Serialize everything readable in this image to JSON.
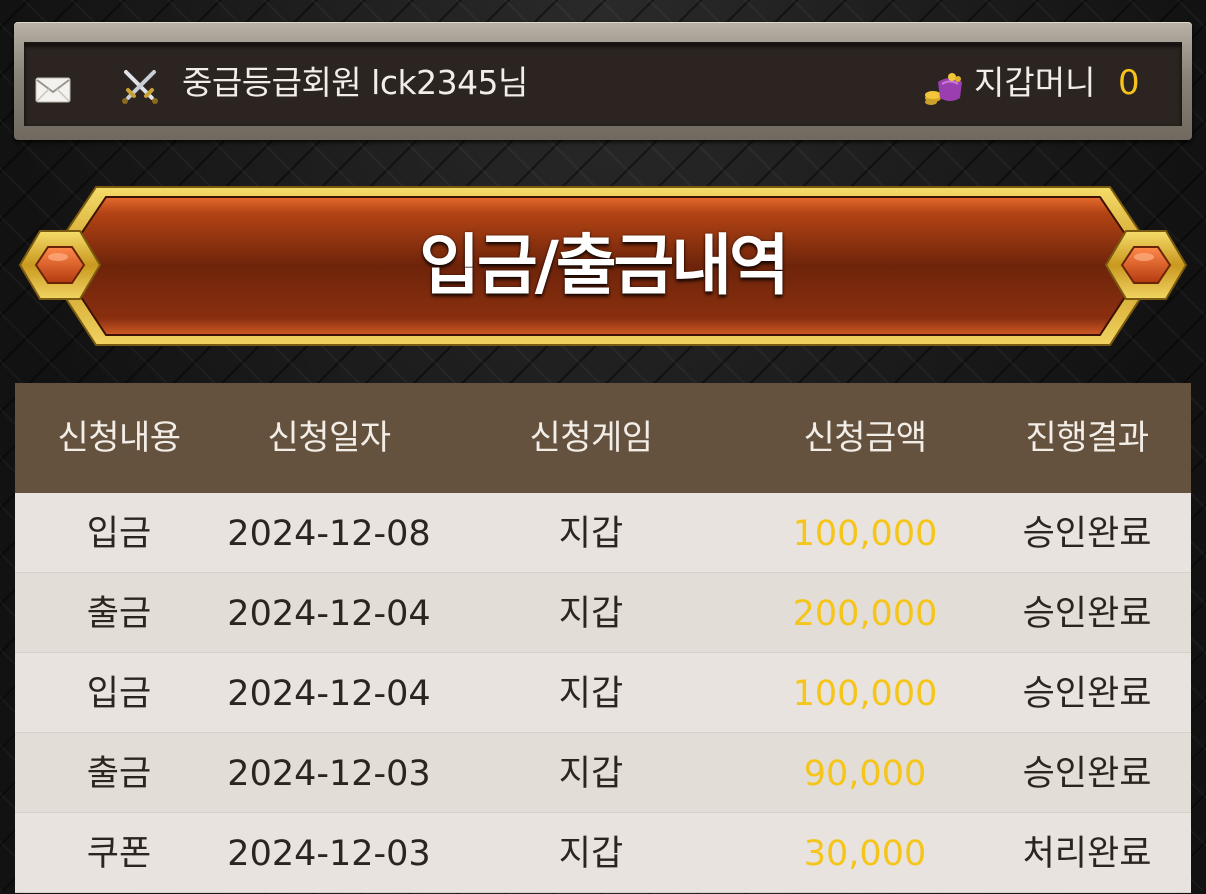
{
  "header": {
    "mail_icon": "envelope-icon",
    "grade_icon": "crossed-swords-icon",
    "member_text": "중급등급회원 lck2345님",
    "wallet_icon": "coin-purse-icon",
    "wallet_label": "지갑머니",
    "wallet_amount": "0"
  },
  "page": {
    "title": "입금/출금내역"
  },
  "table": {
    "columns": [
      "신청내용",
      "신청일자",
      "신청게임",
      "신청금액",
      "진행결과"
    ],
    "rows": [
      {
        "type": "입금",
        "date": "2024-12-08",
        "game": "지갑",
        "amount": "100,000",
        "status": "승인완료"
      },
      {
        "type": "출금",
        "date": "2024-12-04",
        "game": "지갑",
        "amount": "200,000",
        "status": "승인완료"
      },
      {
        "type": "입금",
        "date": "2024-12-04",
        "game": "지갑",
        "amount": "100,000",
        "status": "승인완료"
      },
      {
        "type": "출금",
        "date": "2024-12-03",
        "game": "지갑",
        "amount": "90,000",
        "status": "승인완료"
      },
      {
        "type": "쿠폰",
        "date": "2024-12-03",
        "game": "지갑",
        "amount": "30,000",
        "status": "처리완료"
      }
    ]
  },
  "colors": {
    "amount": "#f5c51a",
    "header_bg": "#64523f",
    "banner_red": "#7a2a0c",
    "banner_gold": "#e2b93a"
  }
}
